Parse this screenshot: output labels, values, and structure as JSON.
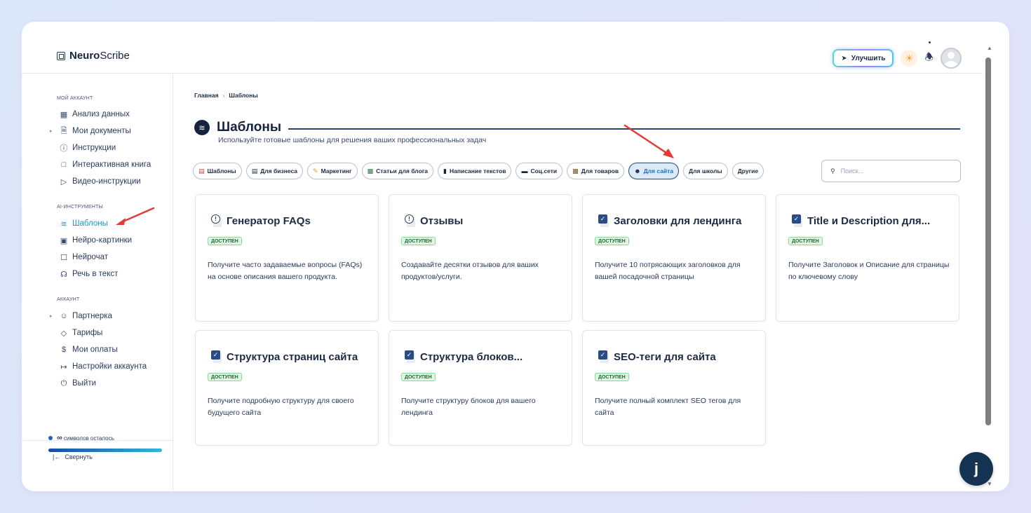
{
  "header": {
    "logo_bold": "Neuro",
    "logo_light": "Scribe",
    "upgrade_label": "Улучшить"
  },
  "sidebar": {
    "section_account": "МОЙ АККАУНТ",
    "section_ai": "AI-ИНСТРУМЕНТЫ",
    "section_acc": "АККАУНТ",
    "items": [
      {
        "label": "Анализ данных",
        "icon": "grid-icon"
      },
      {
        "label": "Мои документы",
        "icon": "document-icon"
      },
      {
        "label": "Инструкции",
        "icon": "help-circle-icon"
      },
      {
        "label": "Интерактивная книга",
        "icon": "book-icon"
      },
      {
        "label": "Видео-инструкции",
        "icon": "video-icon"
      },
      {
        "label": "Шаблоны",
        "icon": "layers-icon"
      },
      {
        "label": "Нейро-картинки",
        "icon": "image-icon"
      },
      {
        "label": "Нейрочат",
        "icon": "chat-icon"
      },
      {
        "label": "Речь в текст",
        "icon": "headphones-icon"
      },
      {
        "label": "Партнерка",
        "icon": "users-icon"
      },
      {
        "label": "Тарифы",
        "icon": "tag-icon"
      },
      {
        "label": "Мои оплаты",
        "icon": "dollar-icon"
      },
      {
        "label": "Настройки аккаунта",
        "icon": "login-icon"
      },
      {
        "label": "Выйти",
        "icon": "power-icon"
      }
    ],
    "quota_symbol": "∞",
    "quota_text": "символов осталось",
    "quota_fill": 1.0,
    "collapse_label": "Свернуть"
  },
  "breadcrumb": {
    "home": "Главная",
    "current": "Шаблоны"
  },
  "page": {
    "title": "Шаблоны",
    "subtitle": "Используйте готовые шаблоны для решения ваших профессиональных задач"
  },
  "filters": [
    {
      "label": "Шаблоны",
      "icon": "chart-icon",
      "active": false
    },
    {
      "label": "Для бизнеса",
      "icon": "briefcase-icon",
      "active": false
    },
    {
      "label": "Маркетинг",
      "icon": "note-icon",
      "active": false
    },
    {
      "label": "Статьи для блога",
      "icon": "buildings-icon",
      "active": false
    },
    {
      "label": "Написание текстов",
      "icon": "phone-icon",
      "active": false
    },
    {
      "label": "Соц.сети",
      "icon": "laptop-icon",
      "active": false
    },
    {
      "label": "Для товаров",
      "icon": "box-icon",
      "active": false
    },
    {
      "label": "Для сайта",
      "icon": "robot-icon",
      "active": true
    },
    {
      "label": "Для школы",
      "icon": "",
      "active": false
    },
    {
      "label": "Другие",
      "icon": "",
      "active": false
    }
  ],
  "search": {
    "placeholder": "Поиск..."
  },
  "cards": [
    {
      "title": "Генератор FAQs",
      "status": "ДОСТУПЕН",
      "desc": "Получите часто задаваемые вопросы (FAQs) на основе описания вашего продукта.",
      "icon": "info-document-icon"
    },
    {
      "title": "Отзывы",
      "status": "ДОСТУПЕН",
      "desc": "Создавайте десятки отзывов для ваших продуктов/услуги.",
      "icon": "info-document-icon"
    },
    {
      "title": "Заголовки для лендинга",
      "status": "ДОСТУПЕН",
      "desc": "Получите 10 потрясающих заголовков для вашей посадочной страницы",
      "icon": "check-document-icon"
    },
    {
      "title": "Title и Description для...",
      "status": "ДОСТУПЕН",
      "desc": "Получите Заголовок и Описание для страницы по ключевому слову",
      "icon": "check-document-icon"
    },
    {
      "title": "Структура страниц сайта",
      "status": "ДОСТУПЕН",
      "desc": "Получите подробную структуру для своего будущего сайта",
      "icon": "check-document-icon"
    },
    {
      "title": "Структура блоков...",
      "status": "ДОСТУПЕН",
      "desc": "Получите структуру блоков для вашего лендинга",
      "icon": "check-document-icon"
    },
    {
      "title": "SEO-теги для сайта",
      "status": "ДОСТУПЕН",
      "desc": "Получите полный комплект SEO тегов для сайта",
      "icon": "check-document-icon"
    }
  ],
  "colors": {
    "accent": "#16a0b8",
    "navy": "#16233f",
    "status_bg": "#dff7e2",
    "annotation_arrow": "#e53935"
  }
}
